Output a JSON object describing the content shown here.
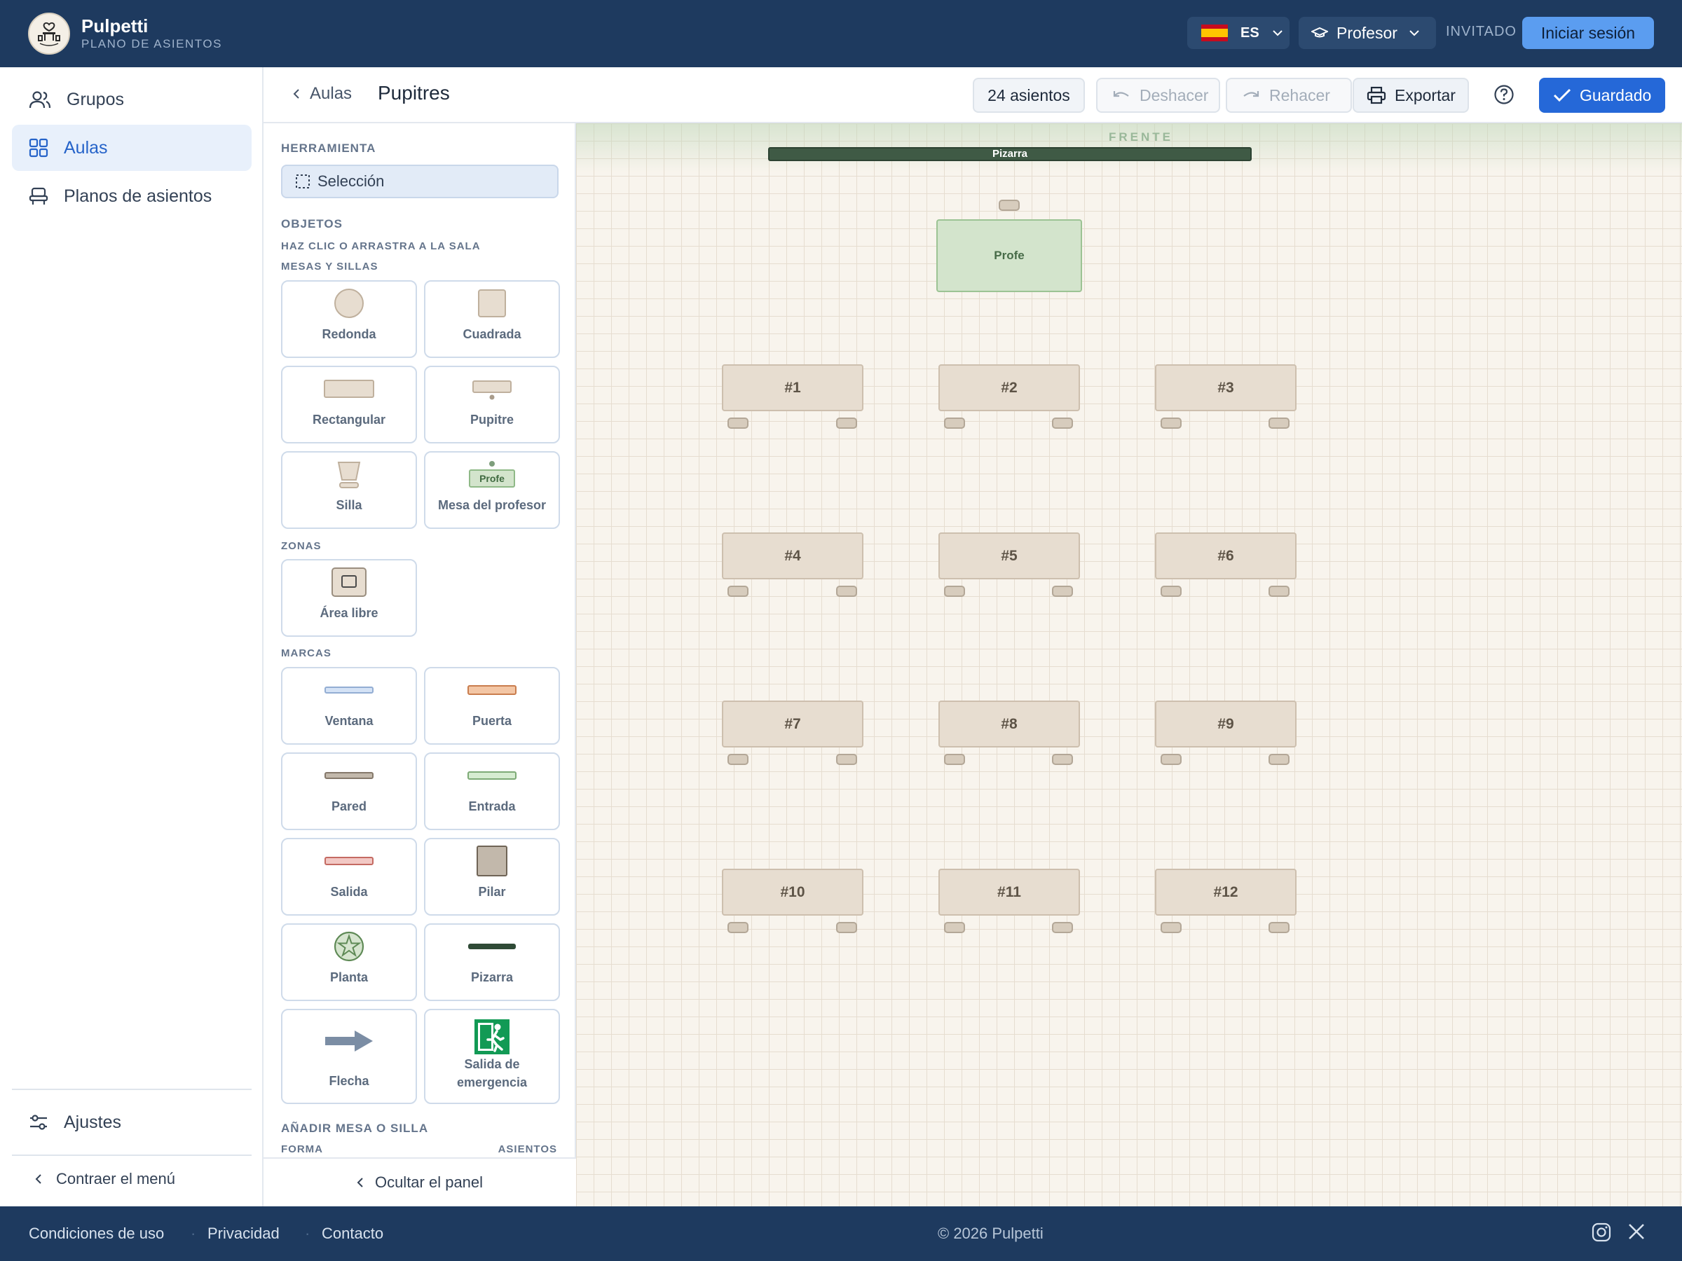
{
  "app": {
    "name": "Pulpetti",
    "subtitle": "PLANO DE ASIENTOS"
  },
  "topbar": {
    "language": {
      "code": "ES",
      "flag": "spain-flag-icon"
    },
    "role": {
      "label": "Profesor"
    },
    "guest_label": "INVITADO",
    "login_label": "Iniciar sesión"
  },
  "sidebar": {
    "items": [
      {
        "label": "Grupos",
        "icon": "users-icon",
        "active": false
      },
      {
        "label": "Aulas",
        "icon": "grid-icon",
        "active": true
      },
      {
        "label": "Planos de asientos",
        "icon": "seat-icon",
        "active": false
      }
    ],
    "settings_label": "Ajustes",
    "collapse_label": "Contraer el menú"
  },
  "header": {
    "back_label": "Aulas",
    "title": "Pupitres",
    "seat_count": "24 asientos",
    "undo_label": "Deshacer",
    "redo_label": "Rehacer",
    "export_label": "Exportar",
    "saved_label": "Guardado"
  },
  "panel": {
    "tool_heading": "HERRAMIENTA",
    "selection_label": "Selección",
    "objects_heading": "OBJETOS",
    "objects_hint": "HAZ CLIC O ARRASTRA A LA SALA",
    "tables_heading": "MESAS Y SILLAS",
    "tables": [
      "Redonda",
      "Cuadrada",
      "Rectangular",
      "Pupitre",
      "Silla",
      "Mesa del profesor"
    ],
    "teacher_icon_text": "Profe",
    "zones_heading": "ZONAS",
    "zones": [
      "Área libre"
    ],
    "marks_heading": "MARCAS",
    "marks": [
      "Ventana",
      "Puerta",
      "Pared",
      "Entrada",
      "Salida",
      "Pilar",
      "Planta",
      "Pizarra",
      "Flecha",
      "Salida de emergencia"
    ],
    "add_heading": "AÑADIR MESA O SILLA",
    "shape_label": "FORMA",
    "seats_label": "ASIENTOS",
    "hide_label": "Ocultar el panel"
  },
  "canvas": {
    "front_label": "FRENTE",
    "board_label": "Pizarra",
    "teacher_desk_label": "Profe",
    "desks": [
      "#1",
      "#2",
      "#3",
      "#4",
      "#5",
      "#6",
      "#7",
      "#8",
      "#9",
      "#10",
      "#11",
      "#12"
    ]
  },
  "footer": {
    "links": [
      "Condiciones de uso",
      "Privacidad",
      "Contacto"
    ],
    "copyright": "© 2026 Pulpetti",
    "social": [
      "instagram-icon",
      "x-icon"
    ]
  },
  "colors": {
    "topbar": "#1e3a5f",
    "accent": "#2568d8",
    "login": "#5b9df0",
    "canvas": "#f8f4ed",
    "desk": "#e7ddd0",
    "teacher_desk": "#d3e4cc",
    "board": "#3f5a45"
  }
}
